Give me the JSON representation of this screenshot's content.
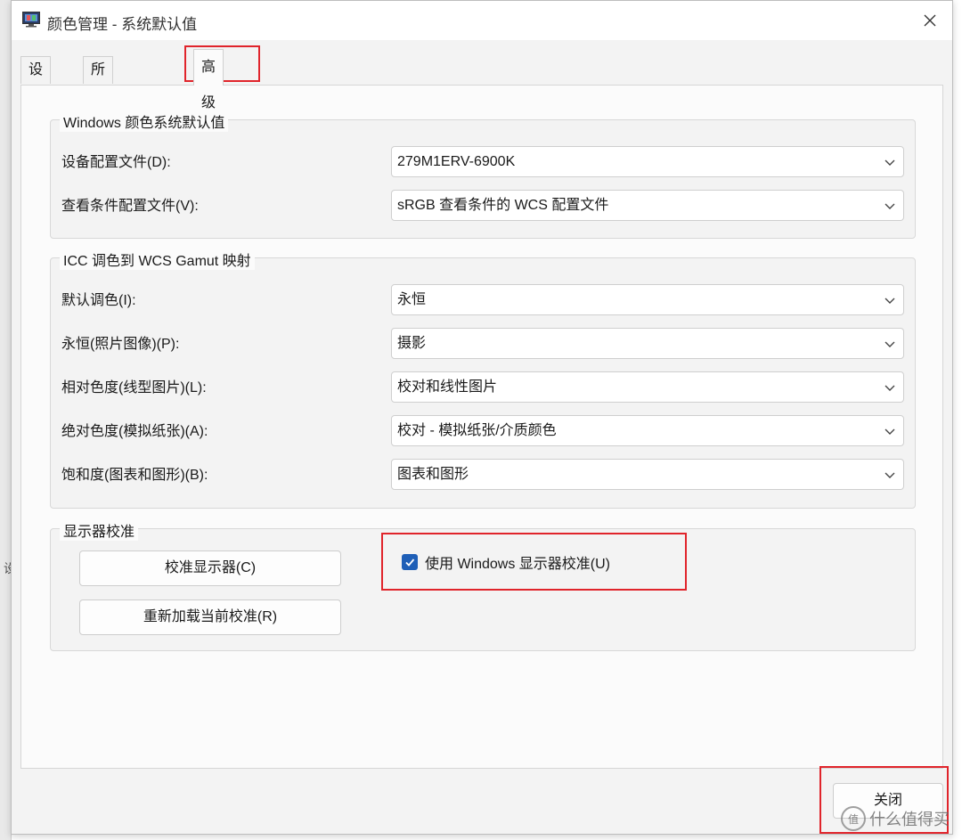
{
  "window": {
    "title": "颜色管理 - 系统默认值"
  },
  "tabs": [
    {
      "label": "设备"
    },
    {
      "label": "所有配置文件"
    },
    {
      "label": "高级"
    }
  ],
  "groups": {
    "windows_defaults": {
      "legend": "Windows 颜色系统默认值",
      "rows": [
        {
          "label": "设备配置文件(D):",
          "value": "279M1ERV-6900K"
        },
        {
          "label": "查看条件配置文件(V):",
          "value": "sRGB 查看条件的 WCS 配置文件"
        }
      ]
    },
    "gamut_mapping": {
      "legend": "ICC 调色到 WCS Gamut 映射",
      "rows": [
        {
          "label": "默认调色(I):",
          "value": "永恒"
        },
        {
          "label": "永恒(照片图像)(P):",
          "value": "摄影"
        },
        {
          "label": "相对色度(线型图片)(L):",
          "value": "校对和线性图片"
        },
        {
          "label": "绝对色度(模拟纸张)(A):",
          "value": "校对 - 模拟纸张/介质颜色"
        },
        {
          "label": "饱和度(图表和图形)(B):",
          "value": "图表和图形"
        }
      ]
    },
    "calibration": {
      "legend": "显示器校准",
      "calibrate_button": "校准显示器(C)",
      "reload_button": "重新加载当前校准(R)",
      "use_windows_calibration": {
        "label": "使用 Windows 显示器校准(U)",
        "checked": true
      }
    }
  },
  "footer": {
    "close_button": "关闭"
  },
  "watermark": {
    "badge": "值",
    "text": "什么值得买"
  },
  "background": {
    "left_fragment": "设"
  },
  "colors": {
    "highlight": "#e0242b",
    "checkbox": "#1f5fb7"
  }
}
